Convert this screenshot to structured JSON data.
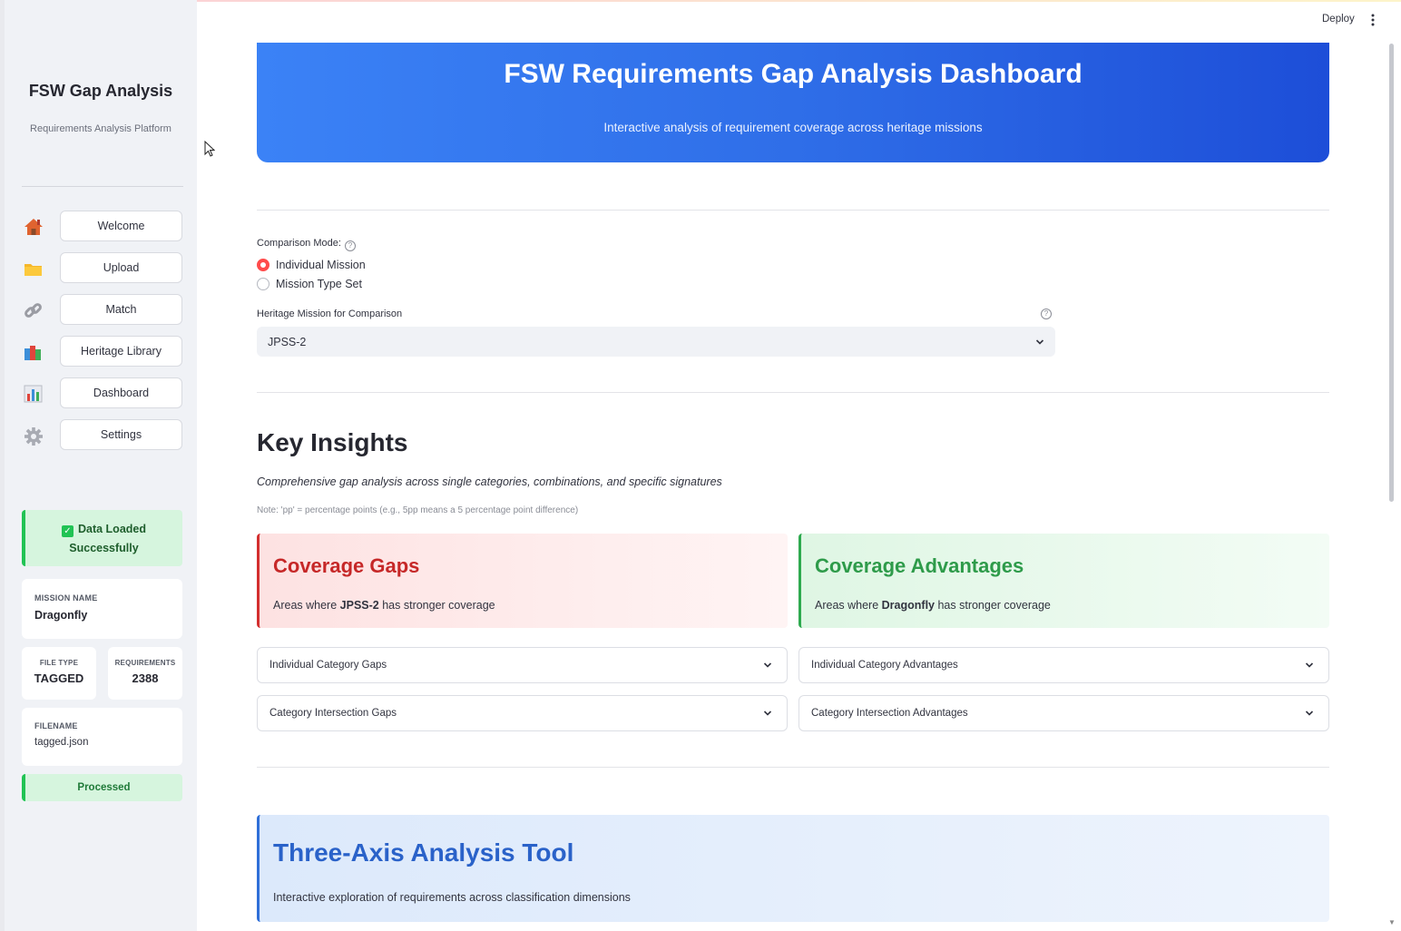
{
  "sidebar": {
    "title": "FSW Gap Analysis",
    "subtitle": "Requirements Analysis Platform",
    "nav": [
      {
        "label": "Welcome",
        "icon": "house-icon"
      },
      {
        "label": "Upload",
        "icon": "folder-icon"
      },
      {
        "label": "Match",
        "icon": "link-icon"
      },
      {
        "label": "Heritage Library",
        "icon": "books-icon"
      },
      {
        "label": "Dashboard",
        "icon": "bar-chart-icon"
      },
      {
        "label": "Settings",
        "icon": "gear-icon"
      }
    ],
    "status": {
      "line1": "Data Loaded",
      "line2": "Successfully"
    },
    "mission_name": {
      "label": "MISSION NAME",
      "value": "Dragonfly"
    },
    "file_type": {
      "label": "FILE TYPE",
      "value": "TAGGED"
    },
    "requirements": {
      "label": "REQUIREMENTS",
      "value": "2388"
    },
    "filename": {
      "label": "FILENAME",
      "value": "tagged.json"
    },
    "processed": "Processed"
  },
  "header": {
    "deploy": "Deploy"
  },
  "hero": {
    "title": "FSW Requirements Gap Analysis Dashboard",
    "subtitle": "Interactive analysis of requirement coverage across heritage missions"
  },
  "comparison": {
    "label": "Comparison Mode:",
    "options": [
      "Individual Mission",
      "Mission Type Set"
    ],
    "selected": "Individual Mission"
  },
  "heritage": {
    "label": "Heritage Mission for Comparison",
    "value": "JPSS-2"
  },
  "insights": {
    "title": "Key Insights",
    "description": "Comprehensive gap analysis across single categories, combinations, and specific signatures",
    "note": "Note: 'pp' = percentage points (e.g., 5pp means a 5 percentage point difference)"
  },
  "gaps": {
    "title": "Coverage Gaps",
    "pre": "Areas where ",
    "mission": "JPSS-2",
    "post": " has stronger coverage",
    "expanders": [
      "Individual Category Gaps",
      "Category Intersection Gaps"
    ]
  },
  "advantages": {
    "title": "Coverage Advantages",
    "pre": "Areas where ",
    "mission": "Dragonfly",
    "post": " has stronger coverage",
    "expanders": [
      "Individual Category Advantages",
      "Category Intersection Advantages"
    ]
  },
  "tool": {
    "title": "Three-Axis Analysis Tool",
    "subtitle": "Interactive exploration of requirements across classification dimensions"
  },
  "colors": {
    "accent": "#ff4b4b",
    "gap": "#c62828",
    "advantage": "#2e9b4a",
    "tool": "#2a62c9",
    "hero": "#2f6ee8"
  }
}
